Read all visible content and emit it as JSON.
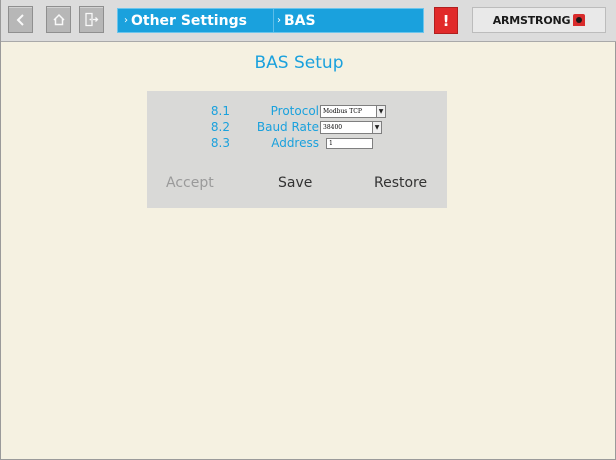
{
  "topbar": {
    "nav_buttons": [
      {
        "icon": "chevron-left-icon"
      },
      {
        "icon": "home-icon"
      },
      {
        "icon": "exit-icon"
      }
    ],
    "breadcrumbs": [
      {
        "label": "Other Settings"
      },
      {
        "label": "BAS"
      }
    ],
    "alarm_label": "!",
    "logo_text": "ARMSTRONG"
  },
  "page": {
    "title": "BAS Setup"
  },
  "form": {
    "rows": [
      {
        "number": "8.1",
        "label": "Protocol",
        "value": "Modbus TCP",
        "control": "select"
      },
      {
        "number": "8.2",
        "label": "Baud Rate",
        "value": "38400",
        "control": "select"
      },
      {
        "number": "8.3",
        "label": "Address",
        "value": "1",
        "control": "text"
      }
    ]
  },
  "actions": {
    "accept": "Accept",
    "save": "Save",
    "restore": "Restore"
  },
  "colors": {
    "accent": "#1aa1dd",
    "background": "#f5f1e1",
    "panel": "#d9d9d7",
    "alarm": "#e12a2a",
    "disabled_text": "#9a9a9a"
  }
}
